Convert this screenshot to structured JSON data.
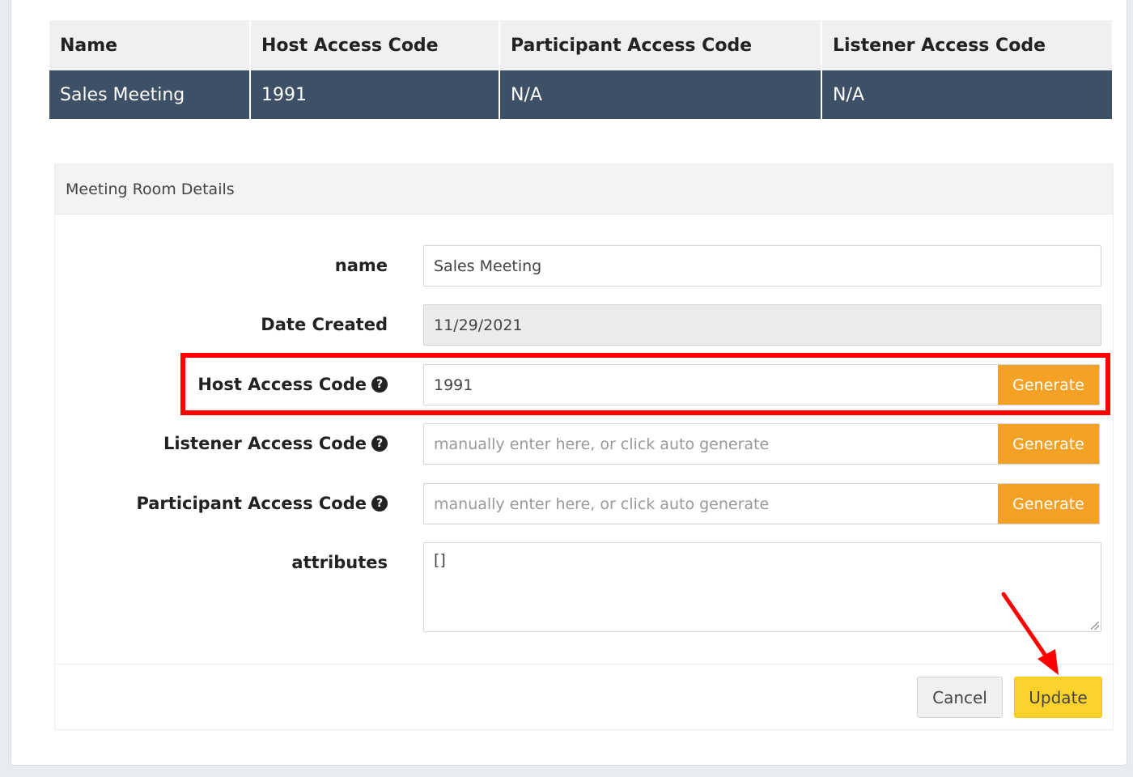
{
  "table": {
    "headers": [
      "Name",
      "Host Access Code",
      "Participant Access Code",
      "Listener Access Code"
    ],
    "row": [
      "Sales Meeting",
      "1991",
      "N/A",
      "N/A"
    ]
  },
  "panel": {
    "title": "Meeting Room Details",
    "fields": {
      "name": {
        "label": "name",
        "value": "Sales Meeting"
      },
      "date_created": {
        "label": "Date Created",
        "value": "11/29/2021"
      },
      "host_code": {
        "label": "Host Access Code",
        "value": "1991",
        "button": "Generate"
      },
      "listener_code": {
        "label": "Listener Access Code",
        "placeholder": "manually enter here, or click auto generate",
        "button": "Generate"
      },
      "participant_code": {
        "label": "Participant Access Code",
        "placeholder": "manually enter here, or click auto generate",
        "button": "Generate"
      },
      "attributes": {
        "label": "attributes",
        "value": "[]"
      }
    },
    "footer": {
      "cancel": "Cancel",
      "update": "Update"
    }
  },
  "icons": {
    "help": "question-circle-icon"
  },
  "colors": {
    "header_row": "#3d5066",
    "generate": "#f4a125",
    "update": "#fbd12b",
    "annotation": "#ff0000"
  }
}
